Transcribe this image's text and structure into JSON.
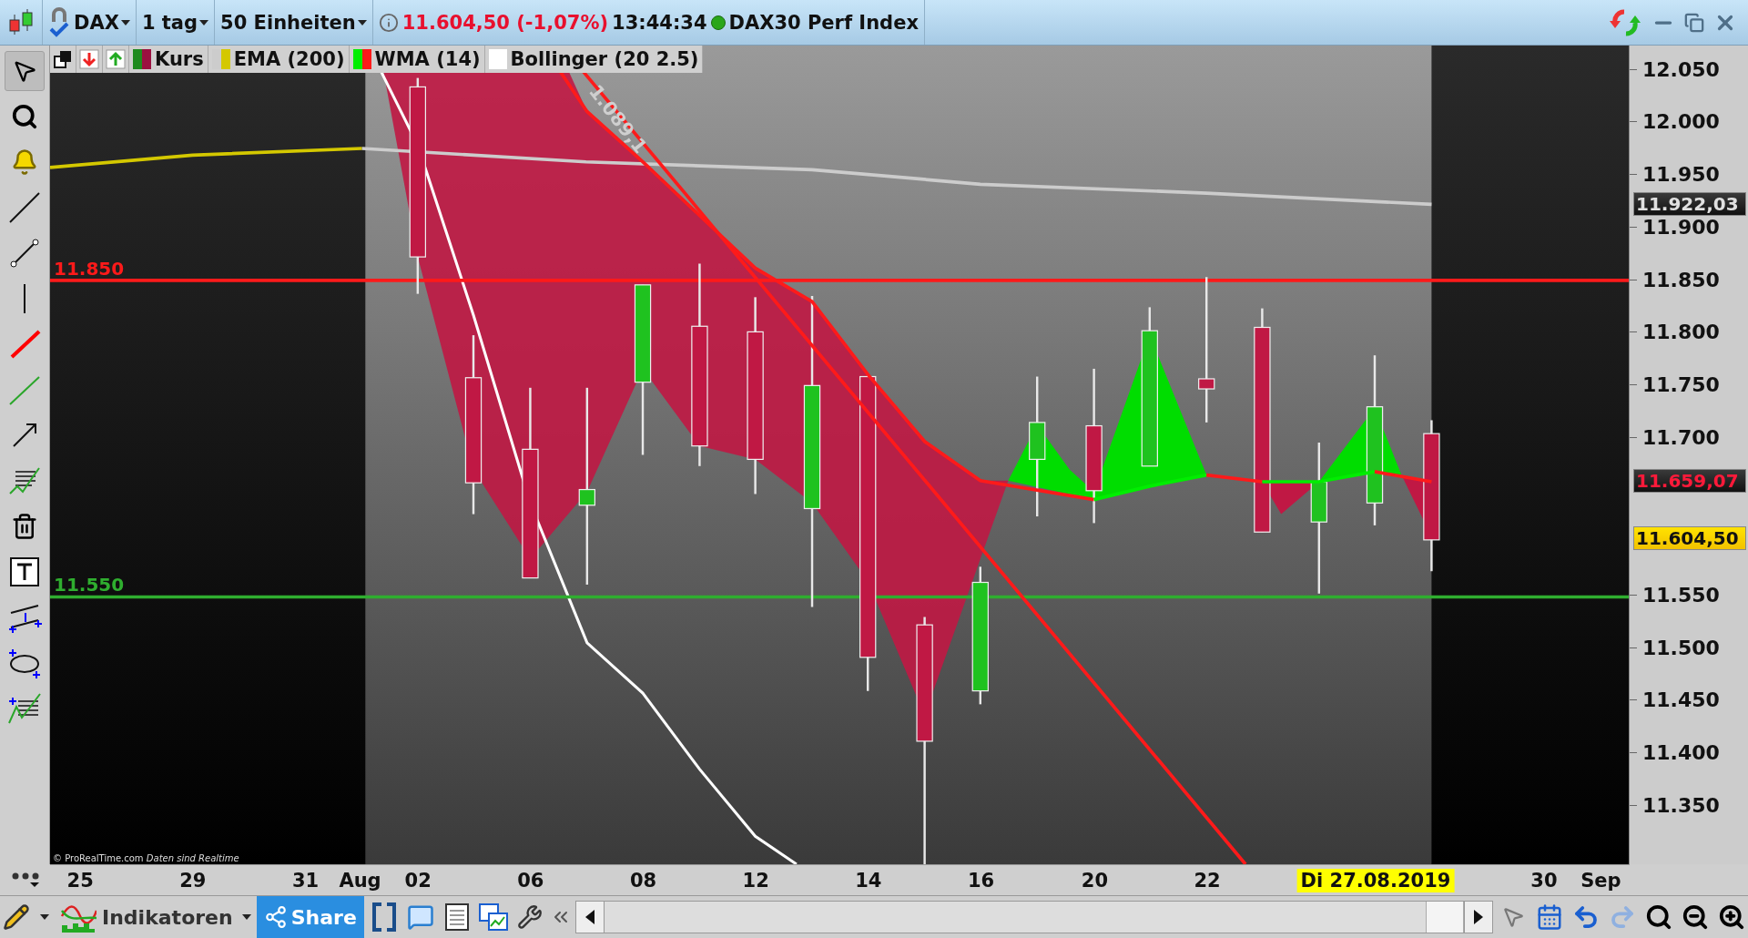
{
  "title_bar": {
    "symbol": "DAX",
    "period": "1 tag",
    "units": "50 Einheiten",
    "price": "11.604,50 (-1,07%)",
    "time": "13:44:34",
    "instrument": "DAX30 Perf Index",
    "status_dot": {
      "color": "#2aa61a"
    }
  },
  "legend": [
    {
      "label": "Kurs",
      "swatches": [
        {
          "color": "#1f8a1f"
        },
        {
          "color": "#9b1040"
        }
      ]
    },
    {
      "label": "EMA (200)",
      "swatches": [
        {
          "color": "#cccccc"
        },
        {
          "color": "#d4c800"
        }
      ]
    },
    {
      "label": "WMA (14)",
      "swatches": [
        {
          "color": "#00ee00"
        },
        {
          "color": "#ff1a1a"
        }
      ]
    },
    {
      "label": "Bollinger (20 2.5)",
      "swatches": [
        {
          "color": "#ffffff"
        }
      ]
    }
  ],
  "chart": {
    "trendline_label": "1.089,1",
    "credit": "© ProRealTime.com",
    "credit_note": "Daten sind Realtime",
    "levels": [
      {
        "label": "11.850",
        "color": "#ff1a1a"
      },
      {
        "label": "11.550",
        "color": "#2fae2f"
      }
    ]
  },
  "y_axis": {
    "ticks": [
      "12.050",
      "12.000",
      "11.950",
      "11.900",
      "11.850",
      "11.800",
      "11.750",
      "11.700",
      "11.550",
      "11.500",
      "11.450",
      "11.400",
      "11.350"
    ],
    "tags": [
      {
        "kind": "dark",
        "text": "11.922,03"
      },
      {
        "kind": "alert",
        "text": "11.659,07"
      },
      {
        "kind": "last",
        "text": "11.604,50"
      }
    ]
  },
  "x_axis": {
    "labels": [
      "25",
      "29",
      "31",
      "Aug",
      "02",
      "06",
      "08",
      "12",
      "14",
      "16",
      "20",
      "22",
      "30",
      "Sep"
    ],
    "cursor_label": "Di 27.08.2019"
  },
  "bottom_toolbar": {
    "indicators": "Indikatoren",
    "share": "Share"
  }
}
